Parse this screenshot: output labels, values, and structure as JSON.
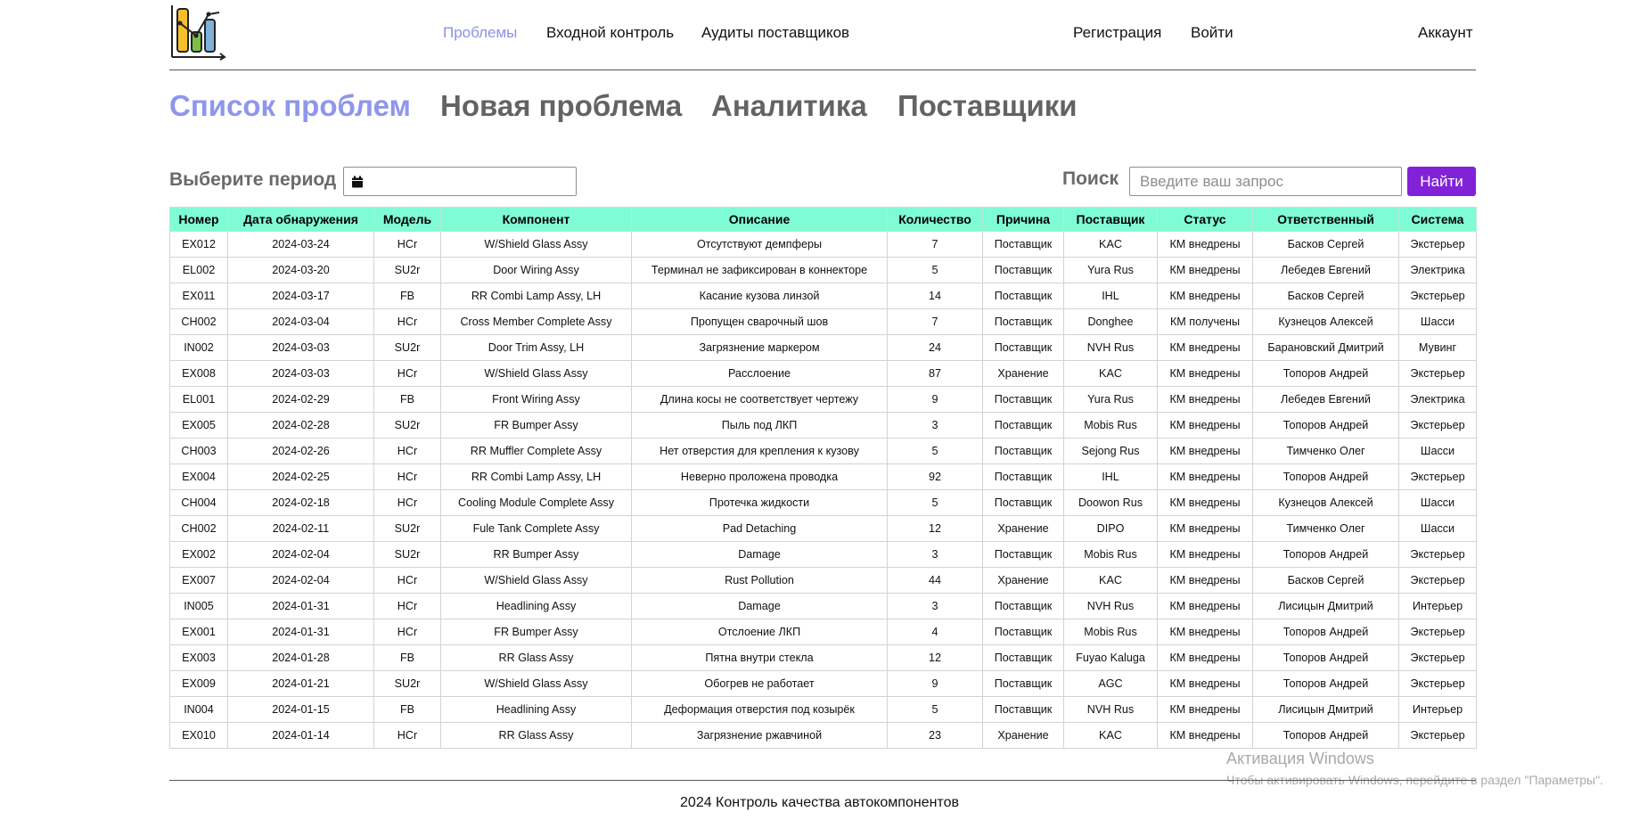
{
  "nav": {
    "problems": "Проблемы",
    "incoming": "Входной контроль",
    "audits": "Аудиты поставщиков",
    "register": "Регистрация",
    "login": "Войти",
    "account": "Аккаунт"
  },
  "tabs": {
    "list": "Список проблем",
    "new": "Новая проблема",
    "analytics": "Аналитика",
    "suppliers": "Поставщики"
  },
  "filters": {
    "period_label": "Выберите период",
    "period_value": "",
    "search_label": "Поиск",
    "search_placeholder": "Введите ваш запрос",
    "search_button": "Найти"
  },
  "table": {
    "headers": [
      "Номер",
      "Дата обнаружения",
      "Модель",
      "Компонент",
      "Описание",
      "Количество",
      "Причина",
      "Поставщик",
      "Статус",
      "Ответственный",
      "Система"
    ],
    "rows": [
      [
        "EX012",
        "2024-03-24",
        "HCr",
        "W/Shield Glass Assy",
        "Отсутствуют демпферы",
        "7",
        "Поставщик",
        "KAC",
        "КМ внедрены",
        "Басков Сергей",
        "Экстерьер"
      ],
      [
        "EL002",
        "2024-03-20",
        "SU2r",
        "Door Wiring Assy",
        "Терминал не зафиксирован в коннекторе",
        "5",
        "Поставщик",
        "Yura Rus",
        "КМ внедрены",
        "Лебедев Евгений",
        "Электрика"
      ],
      [
        "EX011",
        "2024-03-17",
        "FB",
        "RR Combi Lamp Assy, LH",
        "Касание кузова линзой",
        "14",
        "Поставщик",
        "IHL",
        "КМ внедрены",
        "Басков Сергей",
        "Экстерьер"
      ],
      [
        "CH002",
        "2024-03-04",
        "HCr",
        "Cross Member Complete Assy",
        "Пропущен сварочный шов",
        "7",
        "Поставщик",
        "Donghee",
        "КМ получены",
        "Кузнецов Алексей",
        "Шасси"
      ],
      [
        "IN002",
        "2024-03-03",
        "SU2r",
        "Door Trim Assy, LH",
        "Загрязнение маркером",
        "24",
        "Поставщик",
        "NVH Rus",
        "КМ внедрены",
        "Барановский Дмитрий",
        "Мувинг"
      ],
      [
        "EX008",
        "2024-03-03",
        "HCr",
        "W/Shield Glass Assy",
        "Расслоение",
        "87",
        "Хранение",
        "KAC",
        "КМ внедрены",
        "Топоров Андрей",
        "Экстерьер"
      ],
      [
        "EL001",
        "2024-02-29",
        "FB",
        "Front Wiring Assy",
        "Длина косы не соответствует чертежу",
        "9",
        "Поставщик",
        "Yura Rus",
        "КМ внедрены",
        "Лебедев Евгений",
        "Электрика"
      ],
      [
        "EX005",
        "2024-02-28",
        "SU2r",
        "FR Bumper Assy",
        "Пыль под ЛКП",
        "3",
        "Поставщик",
        "Mobis Rus",
        "КМ внедрены",
        "Топоров Андрей",
        "Экстерьер"
      ],
      [
        "CH003",
        "2024-02-26",
        "HCr",
        "RR Muffler Complete Assy",
        "Нет отверстия для крепления к кузову",
        "5",
        "Поставщик",
        "Sejong Rus",
        "КМ внедрены",
        "Тимченко Олег",
        "Шасси"
      ],
      [
        "EX004",
        "2024-02-25",
        "HCr",
        "RR Combi Lamp Assy, LH",
        "Неверно проложена проводка",
        "92",
        "Поставщик",
        "IHL",
        "КМ внедрены",
        "Топоров Андрей",
        "Экстерьер"
      ],
      [
        "CH004",
        "2024-02-18",
        "HCr",
        "Cooling Module Complete Assy",
        "Протечка жидкости",
        "5",
        "Поставщик",
        "Doowon Rus",
        "КМ внедрены",
        "Кузнецов Алексей",
        "Шасси"
      ],
      [
        "CH002",
        "2024-02-11",
        "SU2r",
        "Fule Tank Complete Assy",
        "Pad Detaching",
        "12",
        "Хранение",
        "DIPO",
        "КМ внедрены",
        "Тимченко Олег",
        "Шасси"
      ],
      [
        "EX002",
        "2024-02-04",
        "SU2r",
        "RR Bumper Assy",
        "Damage",
        "3",
        "Поставщик",
        "Mobis Rus",
        "КМ внедрены",
        "Топоров Андрей",
        "Экстерьер"
      ],
      [
        "EX007",
        "2024-02-04",
        "HCr",
        "W/Shield Glass Assy",
        "Rust Pollution",
        "44",
        "Хранение",
        "KAC",
        "КМ внедрены",
        "Басков Сергей",
        "Экстерьер"
      ],
      [
        "IN005",
        "2024-01-31",
        "HCr",
        "Headlining Assy",
        "Damage",
        "3",
        "Поставщик",
        "NVH Rus",
        "КМ внедрены",
        "Лисицын Дмитрий",
        "Интерьер"
      ],
      [
        "EX001",
        "2024-01-31",
        "HCr",
        "FR Bumper Assy",
        "Отслоение ЛКП",
        "4",
        "Поставщик",
        "Mobis Rus",
        "КМ внедрены",
        "Топоров Андрей",
        "Экстерьер"
      ],
      [
        "EX003",
        "2024-01-28",
        "FB",
        "RR Glass Assy",
        "Пятна внутри стекла",
        "12",
        "Поставщик",
        "Fuyao Kaluga",
        "КМ внедрены",
        "Топоров Андрей",
        "Экстерьер"
      ],
      [
        "EX009",
        "2024-01-21",
        "SU2r",
        "W/Shield Glass Assy",
        "Обогрев не работает",
        "9",
        "Поставщик",
        "AGC",
        "КМ внедрены",
        "Топоров Андрей",
        "Экстерьер"
      ],
      [
        "IN004",
        "2024-01-15",
        "FB",
        "Headlining Assy",
        "Деформация отверстия под козырёк",
        "5",
        "Поставщик",
        "NVH Rus",
        "КМ внедрены",
        "Лисицын Дмитрий",
        "Интерьер"
      ],
      [
        "EX010",
        "2024-01-14",
        "HCr",
        "RR Glass Assy",
        "Загрязнение ржавчиной",
        "23",
        "Хранение",
        "KAC",
        "КМ внедрены",
        "Топоров Андрей",
        "Экстерьер"
      ]
    ]
  },
  "watermark": {
    "title": "Активация Windows",
    "subtitle": "Чтобы активировать Windows, перейдите в раздел \"Параметры\"."
  },
  "footer": {
    "text": "2024 Контроль качества автокомпонентов"
  },
  "colors": {
    "accent": "#8122d9",
    "table_header": "#7ffcd4",
    "active_link": "#8a93e8"
  }
}
